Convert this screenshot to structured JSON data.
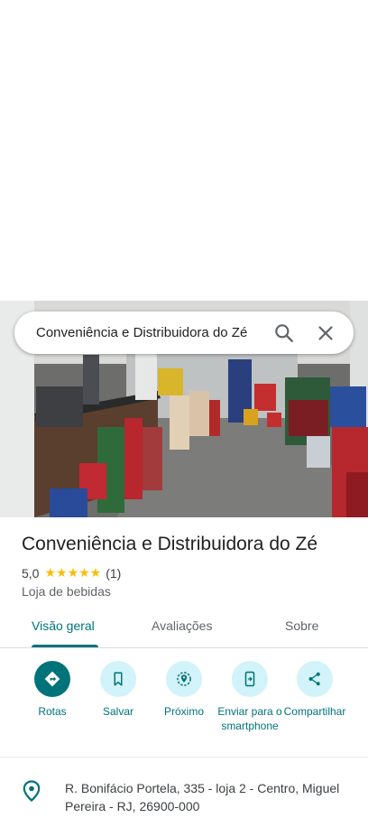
{
  "search": {
    "query": "Conveniência e Distribuidora do Zé"
  },
  "place": {
    "name": "Conveniência e Distribuidora do Zé",
    "rating": "5,0",
    "stars": "★★★★★",
    "review_count": "(1)",
    "category": "Loja de bebidas"
  },
  "tabs": [
    {
      "label": "Visão geral",
      "active": true
    },
    {
      "label": "Avaliações",
      "active": false
    },
    {
      "label": "Sobre",
      "active": false
    }
  ],
  "actions": [
    {
      "label": "Rotas",
      "icon": "directions-icon"
    },
    {
      "label": "Salvar",
      "icon": "bookmark-icon"
    },
    {
      "label": "Próximo",
      "icon": "nearby-icon"
    },
    {
      "label": "Enviar para o smartphone",
      "icon": "send-to-phone-icon"
    },
    {
      "label": "Compartilhar",
      "icon": "share-icon"
    }
  ],
  "address": {
    "text": "R. Bonifácio Portela, 335 - loja 2 - Centro, Miguel Pereira - RJ, 26900-000",
    "icon": "location-pin-icon"
  },
  "colors": {
    "accent": "#00737a",
    "accent_light": "#d1f3f9",
    "star": "#fbbc04"
  }
}
